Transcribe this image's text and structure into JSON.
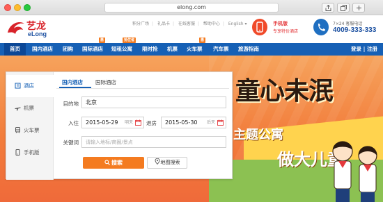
{
  "browser": {
    "url": "elong.com"
  },
  "header": {
    "logo_cn": "艺龙",
    "logo_en": "eLong",
    "top_links": [
      "积分广场",
      "礼品卡",
      "在线客服",
      "帮助中心",
      "English ▾"
    ],
    "mobile_line1": "手机版",
    "mobile_line2": "专享特价酒店",
    "hotline_line1": "7×24 客服电话",
    "hotline_number": "4009-333-333"
  },
  "nav": {
    "items": [
      {
        "label": "首页"
      },
      {
        "label": "国内酒店"
      },
      {
        "label": "团购"
      },
      {
        "label": "国际酒店",
        "badge": "惠"
      },
      {
        "label": "短租公寓",
        "badge": "抢住省"
      },
      {
        "label": "限时抢"
      },
      {
        "label": "机票"
      },
      {
        "label": "火车票",
        "badge": "惠"
      },
      {
        "label": "汽车票"
      },
      {
        "label": "旅游指南"
      }
    ],
    "login": "登录 | 注册"
  },
  "banner": {
    "headline": "童心未泯",
    "sub1": "主题公寓",
    "sub2": "做大儿童"
  },
  "search": {
    "side_items": [
      {
        "label": "酒店",
        "icon": "hotel-icon"
      },
      {
        "label": "机票",
        "icon": "plane-icon"
      },
      {
        "label": "火车票",
        "icon": "train-icon"
      },
      {
        "label": "手机版",
        "icon": "phone-icon"
      }
    ],
    "tabs": [
      "国内酒店",
      "国际酒店"
    ],
    "destination_label": "目的地",
    "destination_value": "北京",
    "checkin_label": "入住",
    "checkin_value": "2015-05-29",
    "checkin_weekday": "明天",
    "checkout_label": "退房",
    "checkout_value": "2015-05-30",
    "checkout_weekday": "后天",
    "keyword_label": "关键词",
    "keyword_placeholder": "请输入地标/商圈/景点",
    "search_button": "搜索",
    "map_button": "地图搜索"
  }
}
